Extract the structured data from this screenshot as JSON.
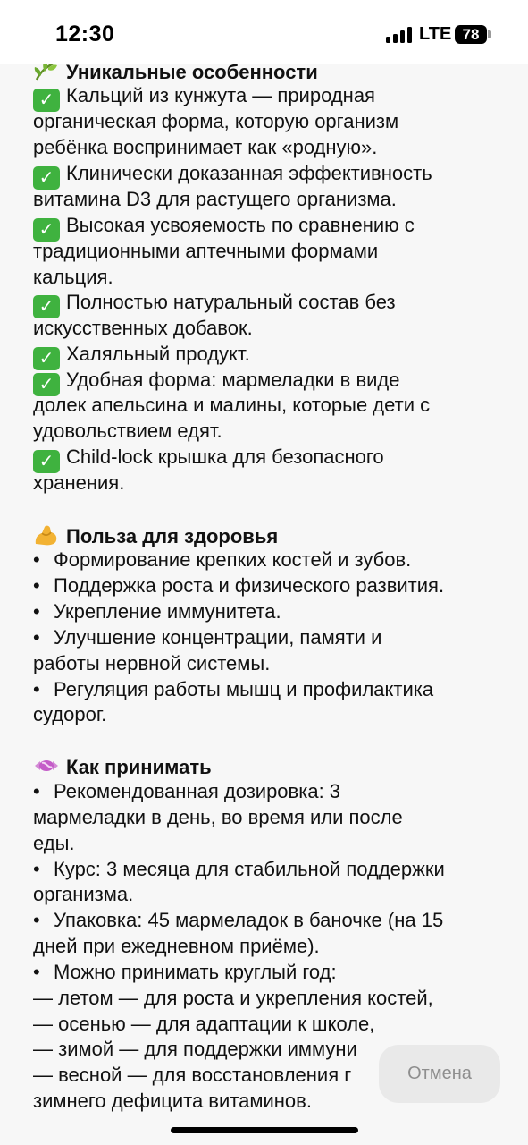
{
  "status_bar": {
    "time": "12:30",
    "network": "LTE",
    "battery": "78"
  },
  "sections": {
    "features": {
      "title": "Уникальные особенности",
      "items": [
        [
          "Кальций из кунжута — природная",
          "органическая форма, которую организм",
          "ребёнка воспринимает как «родную»."
        ],
        [
          "Клинически доказанная эффективность",
          "витамина D3 для растущего организма."
        ],
        [
          "Высокая усвояемость по сравнению с",
          "традиционными аптечными формами",
          "кальция."
        ],
        [
          "Полностью натуральный состав без",
          "искусственных добавок."
        ],
        [
          "Халяльный продукт."
        ],
        [
          "Удобная форма: мармеладки в виде",
          "долек апельсина и малины, которые дети с",
          "удовольствием едят."
        ],
        [
          "Child-lock крышка для безопасного",
          "хранения."
        ]
      ]
    },
    "benefits": {
      "title": "Польза для здоровья",
      "items": [
        [
          "Формирование крепких костей и зубов."
        ],
        [
          "Поддержка роста и физического развития."
        ],
        [
          "Укрепление иммунитета."
        ],
        [
          "Улучшение концентрации, памяти и",
          "работы нервной системы."
        ],
        [
          "Регуляция работы мышц и профилактика",
          "судорог."
        ]
      ]
    },
    "usage": {
      "title": "Как принимать",
      "items": [
        [
          "Рекомендованная дозировка: 3",
          "мармеладки в день, во время или после",
          "еды."
        ],
        [
          "Курс: 3 месяца для стабильной поддержки",
          "организма."
        ],
        [
          "Упаковка: 45 мармеладок в баночке (на 15",
          "дней при ежедневном приёме)."
        ],
        [
          "Можно принимать круглый год:",
          "— летом — для роста и укрепления костей,",
          "— осенью — для адаптации к школе,",
          "— зимой — для поддержки иммуни",
          "— весной — для восстановления г",
          "зимнего дефицита витаминов."
        ]
      ]
    }
  },
  "actions": {
    "cancel_label": "Отмена"
  },
  "colors": {
    "check": "#3fb23f",
    "muted_text": "#8e8e8e"
  },
  "icons": {
    "features": "leaf-icon",
    "check": "check-mark-icon",
    "benefits": "flexed-biceps-icon",
    "usage": "candy-icon"
  }
}
